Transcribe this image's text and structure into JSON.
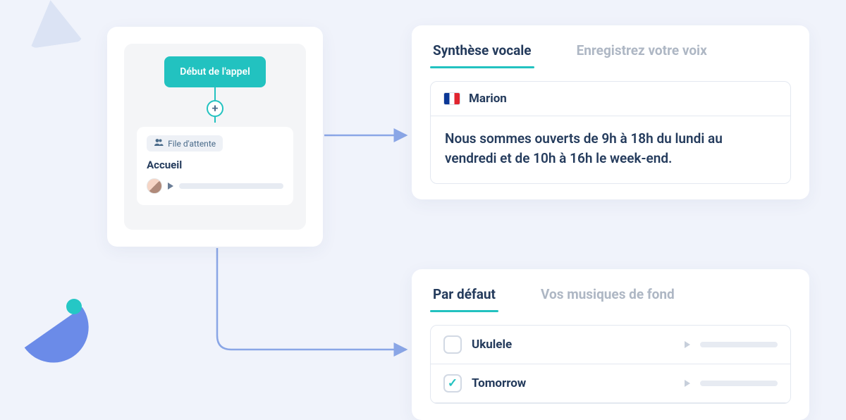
{
  "start_label": "Début de l'appel",
  "queue_pill": "File d'attente",
  "node_title": "Accueil",
  "voice_panel": {
    "tabs": {
      "active": "Synthèse vocale",
      "inactive": "Enregistrez votre voix"
    },
    "voice_name": "Marion",
    "text": "Nous sommes ouverts de 9h à 18h du lundi au vendredi et de 10h à 16h le week-end."
  },
  "music_panel": {
    "tabs": {
      "active": "Par défaut",
      "inactive": "Vos musiques de fond"
    },
    "tracks": [
      {
        "name": "Ukulele",
        "checked": false
      },
      {
        "name": "Tomorrow",
        "checked": true
      }
    ]
  }
}
